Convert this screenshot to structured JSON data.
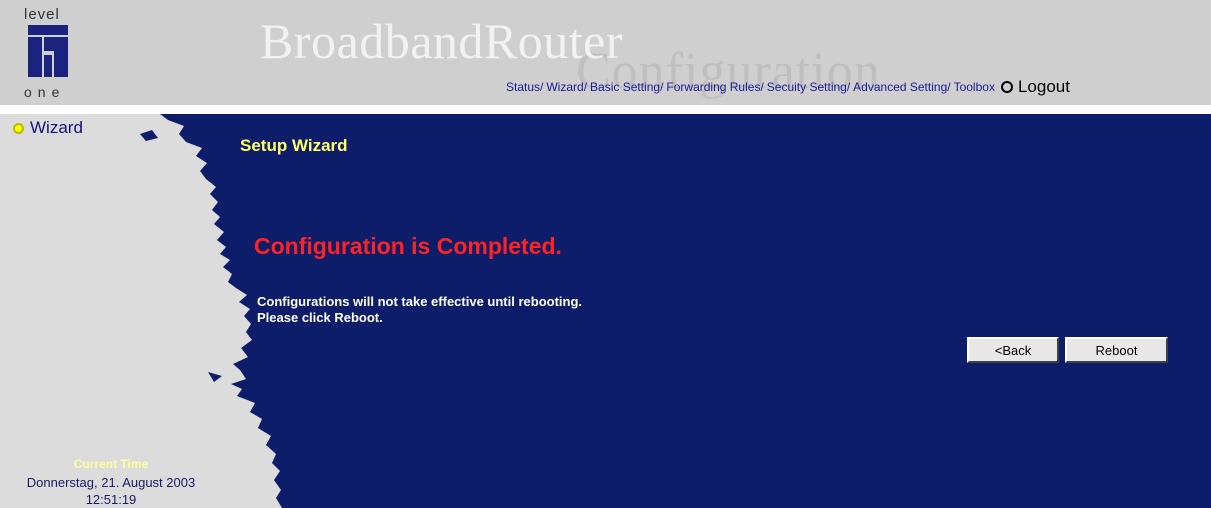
{
  "header": {
    "logo_top": "level",
    "logo_bottom": "one",
    "brand_title": "BroadbandRouter",
    "brand_subtitle": "Configuration",
    "nav": [
      {
        "label": "Status/"
      },
      {
        "label": "Wizard/"
      },
      {
        "label": "Basic Setting/"
      },
      {
        "label": "Forwarding Rules/"
      },
      {
        "label": "Secuity Setting/"
      },
      {
        "label": "Advanced Setting/"
      },
      {
        "label": "Toolbox"
      }
    ],
    "logout_label": "Logout"
  },
  "sidebar": {
    "wizard_label": "Wizard",
    "current_time_label": "Current Time",
    "current_date": "Donnerstag, 21. August 2003",
    "current_clock": "12:51:19"
  },
  "main": {
    "title": "Setup Wizard",
    "headline": "Configuration is Completed.",
    "message_line1": "Configurations will not take effective until rebooting.",
    "message_line2": "Please click Reboot.",
    "back_label": "<Back",
    "reboot_label": "Reboot"
  },
  "colors": {
    "navy": "#0e1d6a",
    "sidebar_gray": "#dcdcdc",
    "header_gray": "#cfcfcf",
    "headline_red": "#ff2222",
    "title_yellow": "#ffff66"
  },
  "icons": {
    "logout": "radio-ring-icon",
    "wizard": "yellow-dot-icon"
  }
}
